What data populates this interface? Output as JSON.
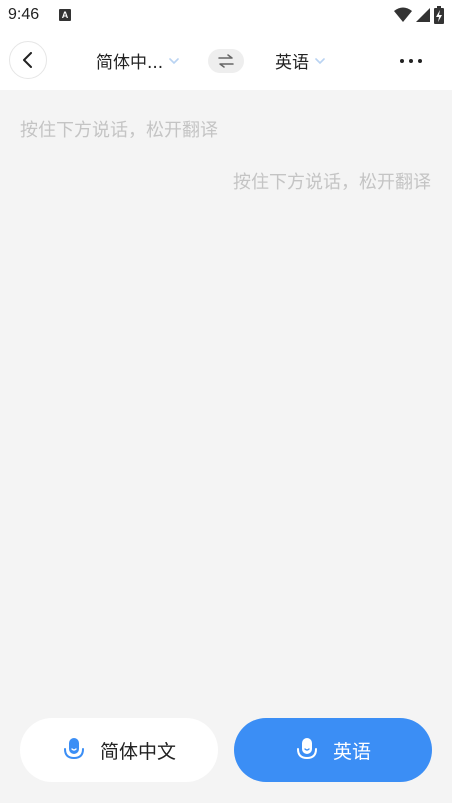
{
  "status_bar": {
    "time": "9:46",
    "notification_icon": "a-letter-icon",
    "wifi_icon": "wifi-icon",
    "signal_icon": "signal-icon",
    "battery_icon": "battery-charging-icon"
  },
  "header": {
    "back_icon": "chevron-left-icon",
    "source_language": "简体中...",
    "target_language": "英语",
    "swap_icon": "swap-arrows-icon",
    "more_icon": "more-dots-icon"
  },
  "content": {
    "source_hint": "按住下方说话，松开翻译",
    "target_hint": "按住下方说话，松开翻译"
  },
  "buttons": {
    "source_label": "简体中文",
    "target_label": "英语",
    "mic_icon": "microphone-icon"
  },
  "colors": {
    "accent": "#3b8ef5",
    "background": "#f4f4f4",
    "hint_text": "#c4c4c4"
  }
}
